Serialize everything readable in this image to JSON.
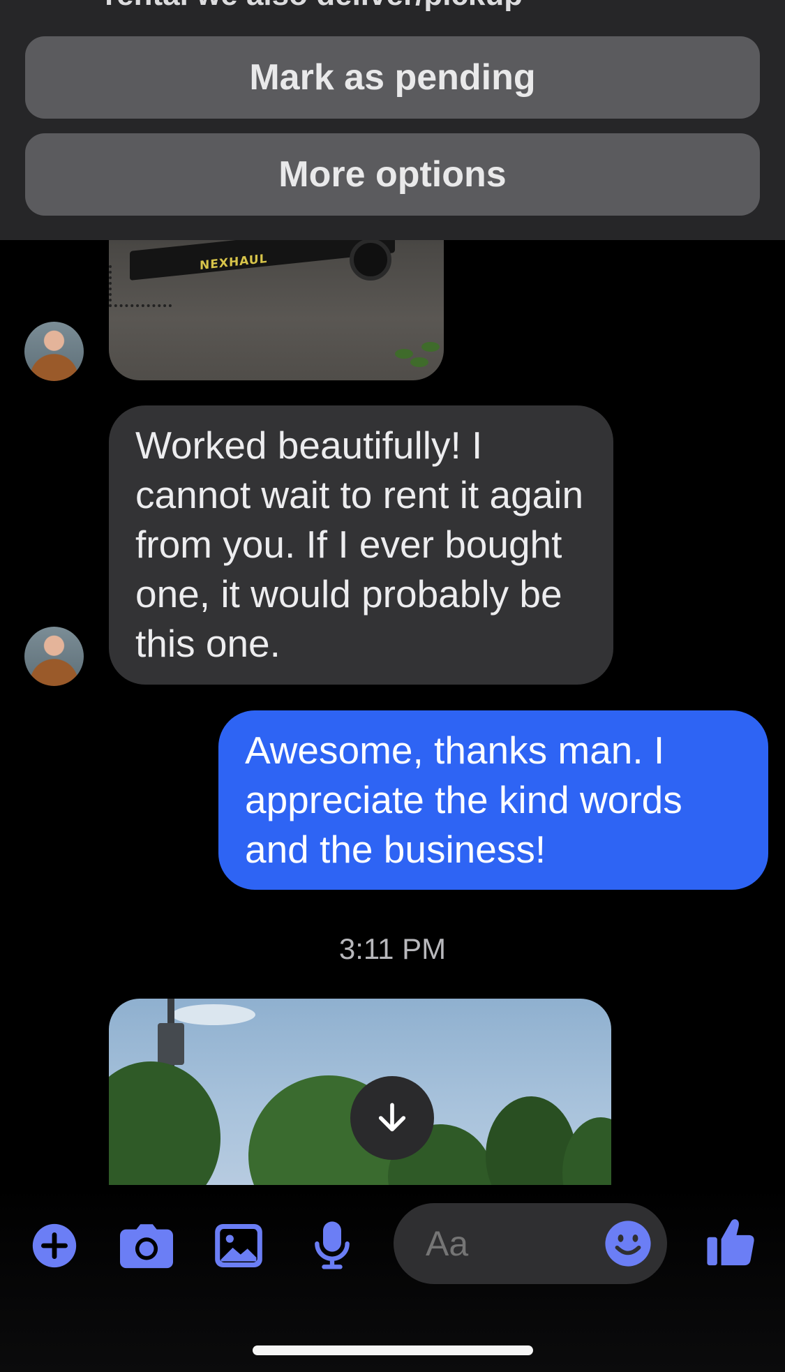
{
  "sheet": {
    "caption": "rental we also deliver/pickup",
    "buttons": [
      {
        "label": "Mark as pending"
      },
      {
        "label": "More options"
      }
    ]
  },
  "photos": {
    "trailer_brand": "NEXHAUL"
  },
  "messages": [
    {
      "direction": "incoming",
      "text": "Worked beautifully! I cannot wait to rent it again from you. If I ever bought one, it would probably be this one."
    },
    {
      "direction": "outgoing",
      "text": "Awesome, thanks man. I appreciate the kind words and the business!"
    }
  ],
  "timestamp": "3:11 PM",
  "composer": {
    "placeholder": "Aa",
    "icons": [
      "plus-icon",
      "camera-icon",
      "gallery-icon",
      "microphone-icon",
      "emoji-icon",
      "thumbs-up-icon"
    ],
    "accent_color": "#6b7ef5"
  },
  "colors": {
    "outgoing_bubble": "#2e64f4",
    "incoming_bubble": "#333335",
    "sheet_background": "#262628",
    "sheet_button": "#5b5b5e"
  }
}
